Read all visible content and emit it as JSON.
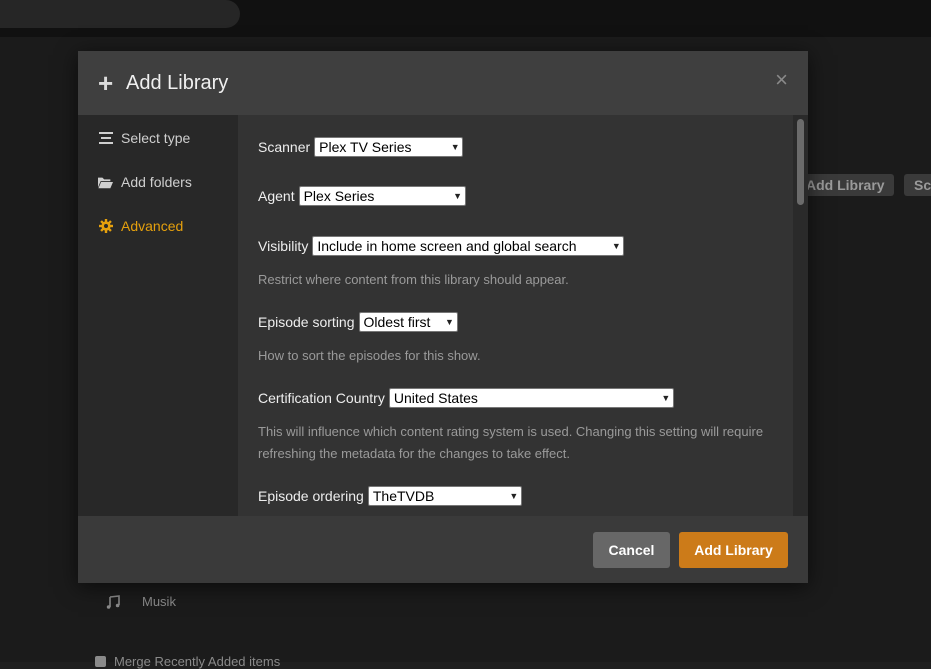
{
  "background": {
    "buttons": [
      "Add Library",
      "Sc"
    ],
    "musik_label": "Musik",
    "merge_label": "Merge Recently Added items"
  },
  "modal": {
    "title": "Add Library",
    "close_glyph": "×",
    "sidebar": {
      "items": [
        {
          "label": "Select type",
          "icon": "list-icon"
        },
        {
          "label": "Add folders",
          "icon": "folder-icon"
        },
        {
          "label": "Advanced",
          "icon": "gear-icon",
          "active": true
        }
      ]
    },
    "fields": {
      "scanner": {
        "label": "Scanner",
        "value": "Plex TV Series"
      },
      "agent": {
        "label": "Agent",
        "value": "Plex Series"
      },
      "visibility": {
        "label": "Visibility",
        "value": "Include in home screen and global search",
        "help": "Restrict where content from this library should appear."
      },
      "episode_sorting": {
        "label": "Episode sorting",
        "value": "Oldest first",
        "help": "How to sort the episodes for this show."
      },
      "certification_country": {
        "label": "Certification Country",
        "value": "United States",
        "help": "This will influence which content rating system is used. Changing this setting will require refreshing the metadata for the changes to take effect."
      },
      "episode_ordering": {
        "label": "Episode ordering",
        "value": "TheTVDB"
      }
    },
    "footer": {
      "cancel_label": "Cancel",
      "add_label": "Add Library"
    }
  },
  "colors": {
    "accent": "#e5a00d",
    "primary_button": "#cc7b19",
    "cancel_button": "#676767"
  }
}
